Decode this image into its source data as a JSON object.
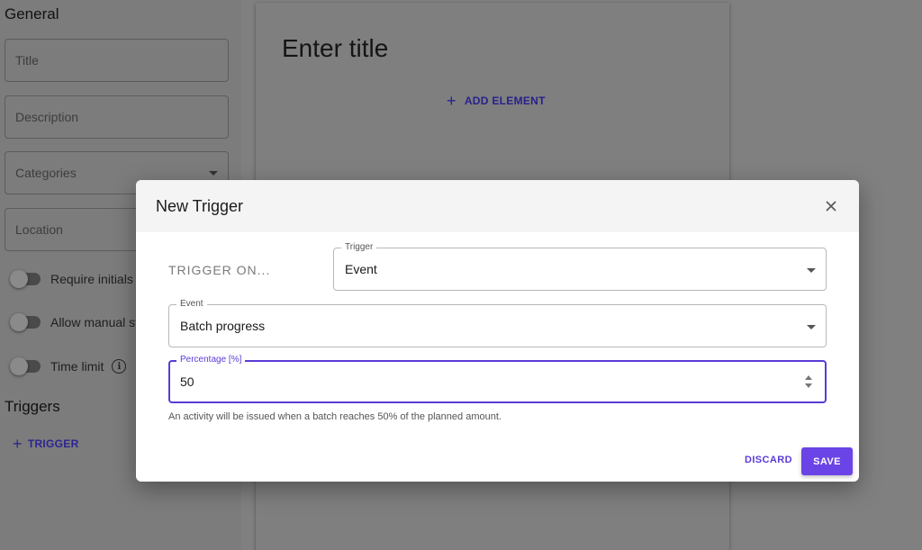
{
  "left_panel": {
    "general_title": "General",
    "fields": [
      {
        "label": "Title"
      },
      {
        "label": "Description"
      },
      {
        "label": "Categories"
      },
      {
        "label": "Location"
      }
    ],
    "toggles": [
      {
        "label": "Require initials"
      },
      {
        "label": "Allow manual st"
      },
      {
        "label": "Time limit"
      }
    ],
    "triggers_title": "Triggers",
    "trigger_button": "TRIGGER"
  },
  "card": {
    "title": "Enter title",
    "add_element": "ADD ELEMENT"
  },
  "dialog": {
    "title": "New Trigger",
    "trigger_on_label": "TRIGGER ON...",
    "trigger_field": {
      "legend": "Trigger",
      "value": "Event"
    },
    "event_field": {
      "legend": "Event",
      "value": "Batch progress"
    },
    "percentage_field": {
      "legend": "Percentage [%]",
      "value": "50"
    },
    "helper_text": "An activity will be issued when a batch reaches 50% of the planned amount.",
    "discard_label": "DISCARD",
    "save_label": "SAVE"
  },
  "colors": {
    "accent": "#6a44e6",
    "link": "#5b3bd6",
    "overlay": "#808080"
  }
}
